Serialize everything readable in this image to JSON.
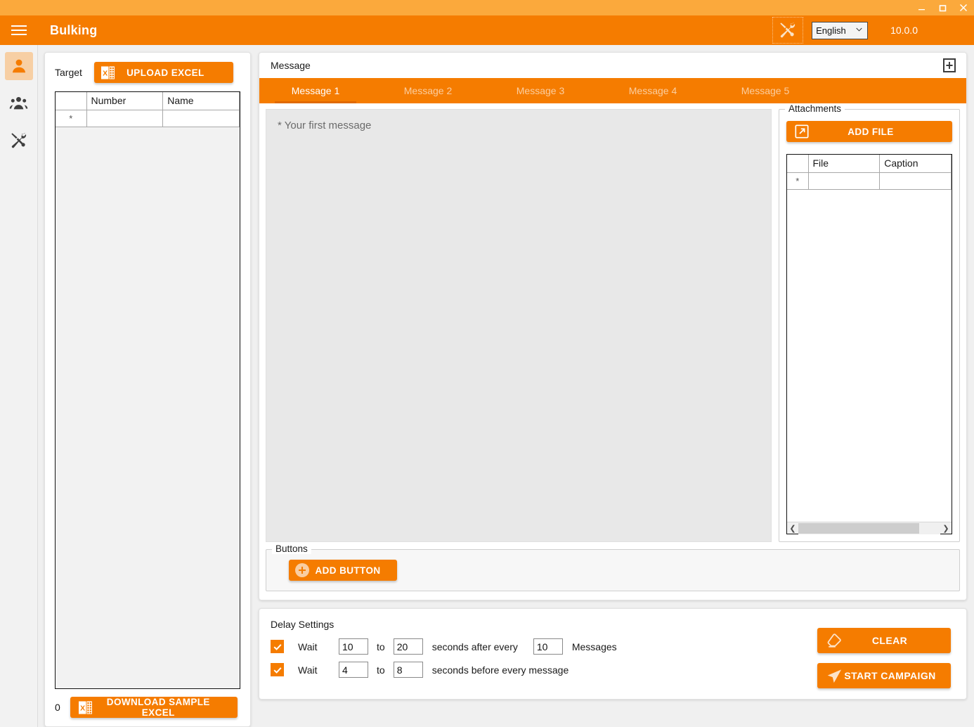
{
  "window": {
    "minimize": "minimize-icon",
    "maximize": "maximize-icon",
    "close": "close-icon"
  },
  "appbar": {
    "menu_icon": "hamburger-icon",
    "title": "Bulking",
    "tools_icon": "tools-icon",
    "language": "English",
    "language_options": [
      "English"
    ],
    "version": "10.0.0"
  },
  "sidebar": {
    "items": [
      {
        "name": "contacts",
        "icon": "person-icon",
        "active": true
      },
      {
        "name": "groups",
        "icon": "people-group-icon",
        "active": false
      },
      {
        "name": "settings",
        "icon": "tools-icon",
        "active": false
      }
    ]
  },
  "target": {
    "label": "Target",
    "upload_button": "UPLOAD EXCEL",
    "upload_icon": "excel-icon",
    "columns": [
      "",
      "Number",
      "Name"
    ],
    "rows": [
      {
        "marker": "*",
        "number": "",
        "name": ""
      }
    ],
    "count": "0",
    "sample_button": "DOWNLOAD SAMPLE EXCEL",
    "sample_icon": "excel-icon"
  },
  "message": {
    "header_title": "Message",
    "add_tab_icon": "add-square-icon",
    "tabs": [
      {
        "label": "Message 1",
        "active": true
      },
      {
        "label": "Message 2",
        "active": false
      },
      {
        "label": "Message 3",
        "active": false
      },
      {
        "label": "Message 4",
        "active": false
      },
      {
        "label": "Message 5",
        "active": false
      }
    ],
    "editor_placeholder": "* Your first message",
    "editor_value": ""
  },
  "attachments": {
    "legend": "Attachments",
    "add_file_button": "ADD FILE",
    "add_file_icon": "external-link-icon",
    "columns": [
      "",
      "File",
      "Caption"
    ],
    "rows": [
      {
        "marker": "*",
        "file": "",
        "caption": ""
      }
    ],
    "scroll_left_icon": "chevron-left-icon",
    "scroll_right_icon": "chevron-right-icon"
  },
  "buttons_section": {
    "legend": "Buttons",
    "add_button_label": "ADD BUTTON",
    "add_button_icon": "plus-circle-icon"
  },
  "delay": {
    "title": "Delay Settings",
    "row1": {
      "checked": true,
      "wait_label": "Wait",
      "from": "10",
      "to_label": "to",
      "to": "20",
      "middle_label": "seconds after every",
      "count": "10",
      "unit_label": "Messages"
    },
    "row2": {
      "checked": true,
      "wait_label": "Wait",
      "from": "4",
      "to_label": "to",
      "to": "8",
      "trailing_label": "seconds before every message"
    },
    "clear_button": "CLEAR",
    "clear_icon": "eraser-icon",
    "start_button": "START CAMPAIGN",
    "start_icon": "send-icon"
  },
  "colors": {
    "titlebar": "#fba93c",
    "appbar": "#f57c00",
    "accent": "#f57c00",
    "accent_dark": "#e06a00",
    "sidebar_active": "#f7cfa4",
    "editor_bg": "#e8e8e8",
    "page_bg": "#f0f0f0"
  }
}
